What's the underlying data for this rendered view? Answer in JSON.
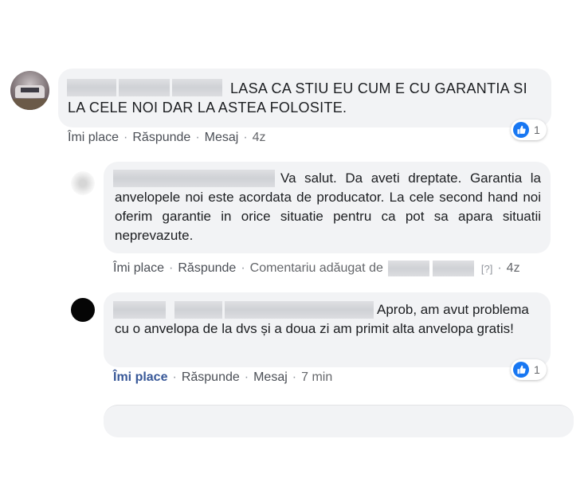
{
  "comments": [
    {
      "text": "LASA CA STIU EU CUM E CU GARANTIA SI LA CELE NOI DAR LA ASTEA FOLOSITE.",
      "actions": {
        "like": "Îmi place",
        "reply": "Răspunde",
        "message": "Mesaj",
        "time": "4z"
      },
      "reaction_count": "1"
    },
    {
      "text": "Va salut. Da aveti dreptate. Garantia la anvelopele noi este acordata de producator. La cele second hand noi oferim garantie in orice situatie pentru ca pot sa apara situatii neprevazute.",
      "actions": {
        "like": "Îmi place",
        "reply": "Răspunde",
        "added_by": "Comentariu adăugat de",
        "help": "[?]",
        "time": "4z"
      }
    },
    {
      "text": "Aprob, am avut problema cu o anvelopa de la dvs și a doua zi am primit alta anvelopa gratis!",
      "actions": {
        "like": "Îmi place",
        "reply": "Răspunde",
        "message": "Mesaj",
        "time": "7 min"
      },
      "reaction_count": "1"
    }
  ],
  "icons": {
    "reaction": "like-thumb-icon"
  },
  "colors": {
    "bubble": "#f2f3f5",
    "like_blue": "#1877f2",
    "link_blue": "#385898",
    "meta_gray": "#65676b"
  }
}
